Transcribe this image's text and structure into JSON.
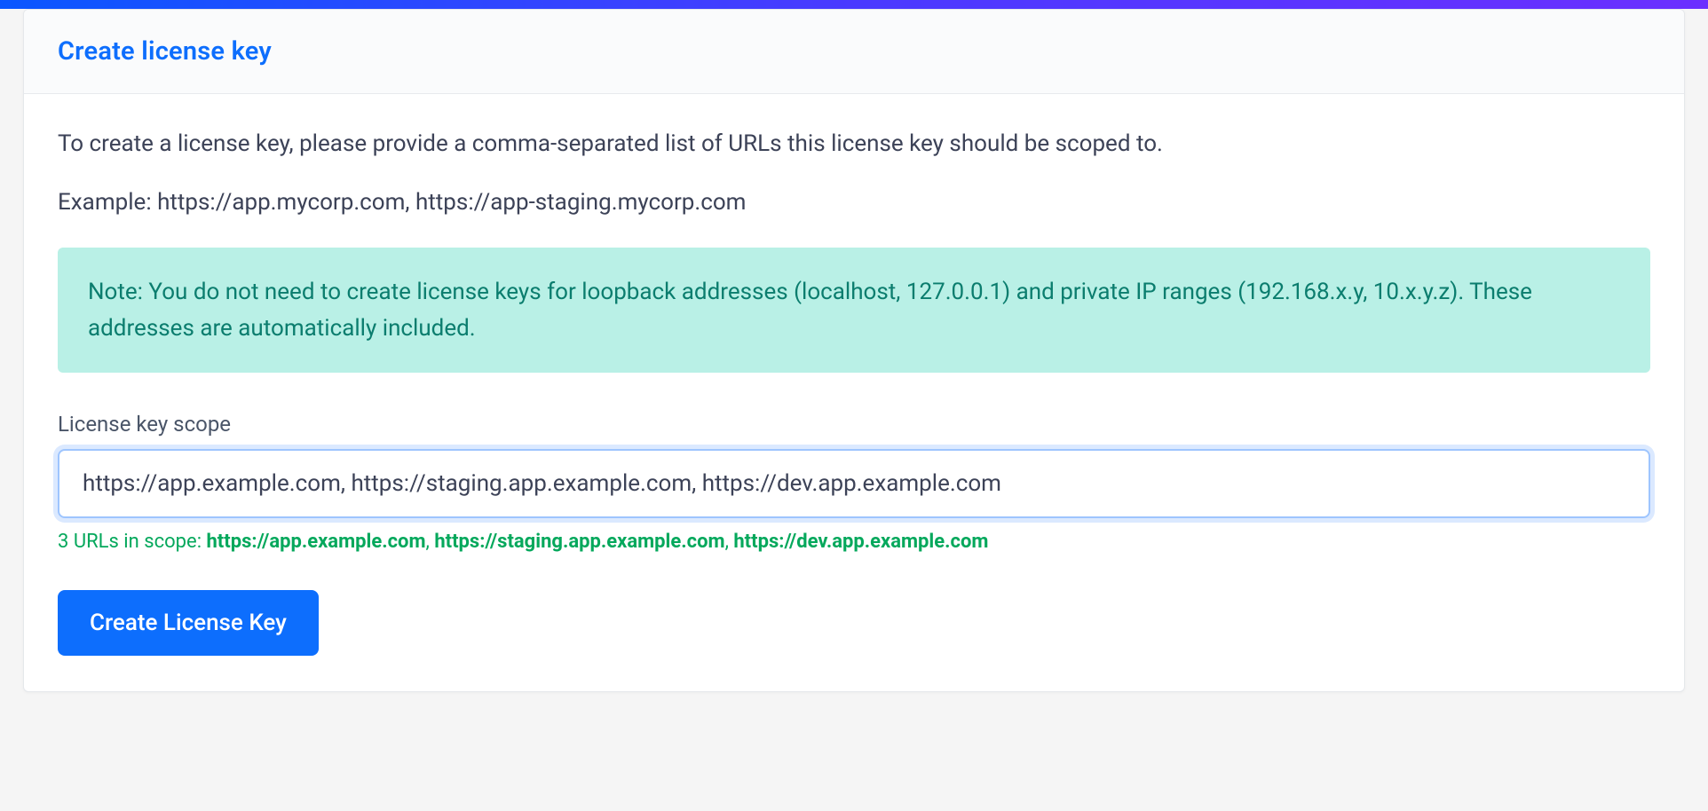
{
  "header": {
    "title": "Create license key"
  },
  "body": {
    "instruction": "To create a license key, please provide a comma-separated list of URLs this license key should be scoped to.",
    "example": "Example: https://app.mycorp.com, https://app-staging.mycorp.com",
    "note": "Note: You do not need to create license keys for loopback addresses (localhost, 127.0.0.1) and private IP ranges (192.168.x.y, 10.x.y.z). These addresses are automatically included.",
    "field_label": "License key scope",
    "input_value": "https://app.example.com, https://staging.app.example.com, https://dev.app.example.com",
    "validation_prefix": "3 URLs in scope: ",
    "validation_urls": [
      "https://app.example.com",
      "https://staging.app.example.com",
      "https://dev.app.example.com"
    ],
    "submit_label": "Create License Key"
  }
}
